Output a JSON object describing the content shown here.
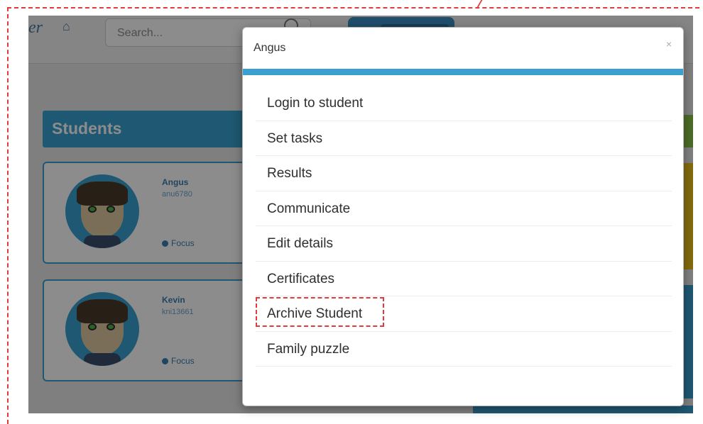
{
  "app": {
    "logo_text": "er",
    "search_placeholder": "Search...",
    "students_heading": "Students",
    "students": [
      {
        "name": "Angus",
        "username": "anu6780",
        "focus_label": "Focus"
      },
      {
        "name": "Kevin",
        "username": "kni13661",
        "focus_label": "Focus"
      }
    ]
  },
  "modal": {
    "title": "Angus",
    "close_glyph": "×",
    "items": [
      "Login to student",
      "Set tasks",
      "Results",
      "Communicate",
      "Edit details",
      "Certificates",
      "Archive Student",
      "Family puzzle"
    ],
    "highlighted_item": "Archive Student"
  },
  "colors": {
    "accent": "#3aa0d0",
    "annotation": "#e23b3b"
  }
}
